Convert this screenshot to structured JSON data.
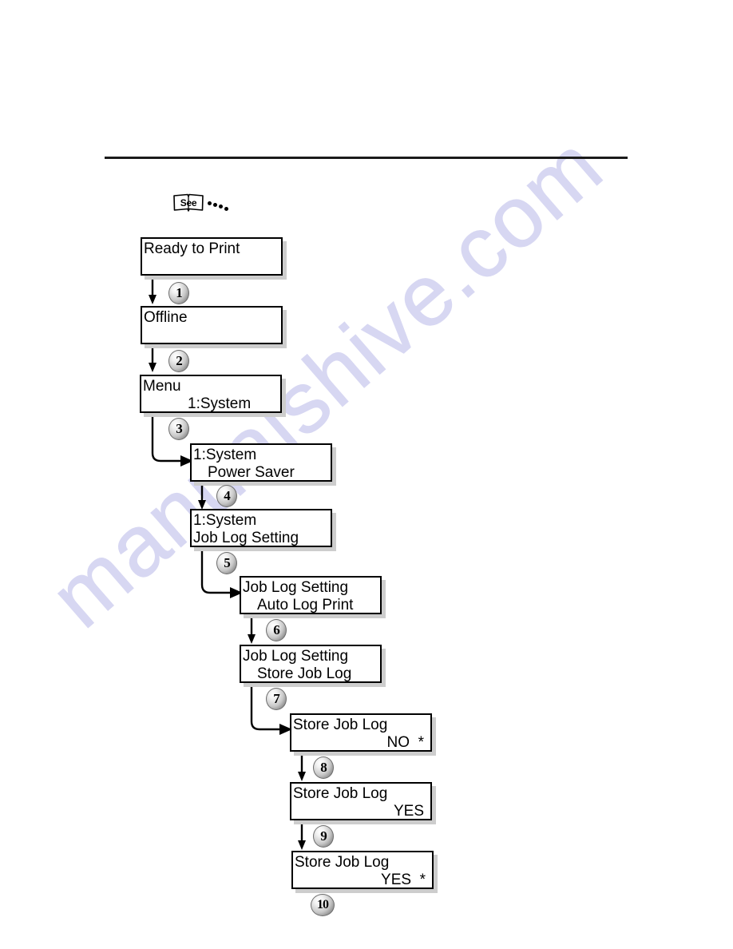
{
  "document": {
    "watermark_text": "manualshive.com",
    "watermark_color": "#d7d7f2",
    "rule_color": "#1b1b1b"
  },
  "see_marker": {
    "label": "See",
    "icon": "open-book-icon",
    "dots": 4
  },
  "flow": {
    "panels": [
      {
        "id": "ready-to-print",
        "line1": "Ready to Print",
        "line2": ""
      },
      {
        "id": "offline",
        "line1": "Offline",
        "line2": ""
      },
      {
        "id": "menu-system",
        "line1": "Menu",
        "line2": "1:System"
      },
      {
        "id": "system-power-saver",
        "line1": "1:System",
        "line2": "Power Saver"
      },
      {
        "id": "system-job-log-setting",
        "line1": "1:System",
        "line2": "Job Log Setting"
      },
      {
        "id": "job-log-setting-auto-log-print",
        "line1": "Job Log Setting",
        "line2": "Auto Log Print"
      },
      {
        "id": "job-log-setting-store-job-log",
        "line1": "Job Log Setting",
        "line2": "Store Job Log"
      },
      {
        "id": "store-job-log-no",
        "line1": "Store Job Log",
        "line2": "NO  *"
      },
      {
        "id": "store-job-log-yes",
        "line1": "Store Job Log",
        "line2": "YES"
      },
      {
        "id": "store-job-log-yes-selected",
        "line1": "Store Job Log",
        "line2": "YES  *"
      }
    ],
    "steps": [
      {
        "n": "1",
        "label": "①"
      },
      {
        "n": "2",
        "label": "②"
      },
      {
        "n": "3",
        "label": "③"
      },
      {
        "n": "4",
        "label": "④"
      },
      {
        "n": "5",
        "label": "⑤"
      },
      {
        "n": "6",
        "label": "⑥"
      },
      {
        "n": "7",
        "label": "⑦"
      },
      {
        "n": "8",
        "label": "⑧"
      },
      {
        "n": "9",
        "label": "⑨"
      },
      {
        "n": "10",
        "label": "⑩"
      }
    ]
  }
}
